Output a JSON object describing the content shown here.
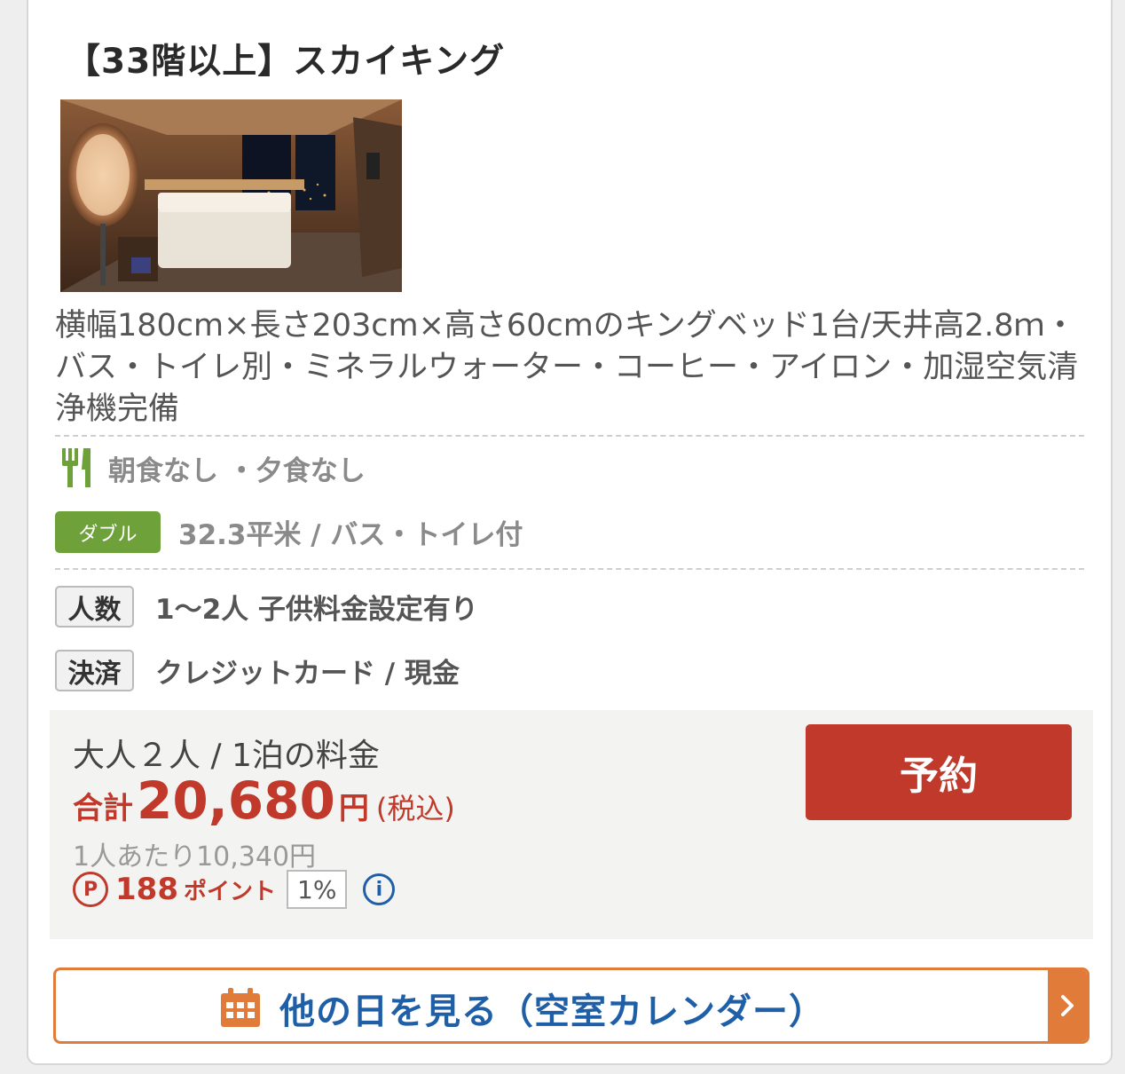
{
  "room": {
    "title": "【33階以上】スカイキング",
    "description": "横幅180cm×長さ203cm×高さ60cmのキングベッド1台/天井高2.8ｍ・バス・トイレ別・ミネラルウォーター・コーヒー・アイロン・加湿空気清浄機完備",
    "meals": "朝食なし ・夕食なし",
    "room_type_badge": "ダブル",
    "room_type_text": "32.3平米 / バス・トイレ付",
    "people_tag": "人数",
    "people_text": "1～2人 子供料金設定有り",
    "payment_tag": "決済",
    "payment_text": "クレジットカード / 現金"
  },
  "price": {
    "label": "大人２人 / 1泊の料金",
    "total_label": "合計",
    "total_amount": "20,680",
    "total_yen": "円",
    "tax_note": "(税込)",
    "per_person": "1人あたり10,340円",
    "points_symbol": "P",
    "points_value": "188",
    "points_unit": "ポイント",
    "points_rate": "1%",
    "info_symbol": "i",
    "reserve_label": "予約"
  },
  "calendar_button": {
    "label": "他の日を見る（空室カレンダー）"
  },
  "colors": {
    "accent_red": "#c0392b",
    "badge_green": "#6fa13b",
    "link_blue": "#1f5fa8",
    "orange": "#e07b39"
  },
  "icons": {
    "meal": "utensils-icon",
    "calendar": "calendar-icon",
    "chevron": "chevron-right-icon",
    "points": "points-icon",
    "info": "info-icon"
  }
}
